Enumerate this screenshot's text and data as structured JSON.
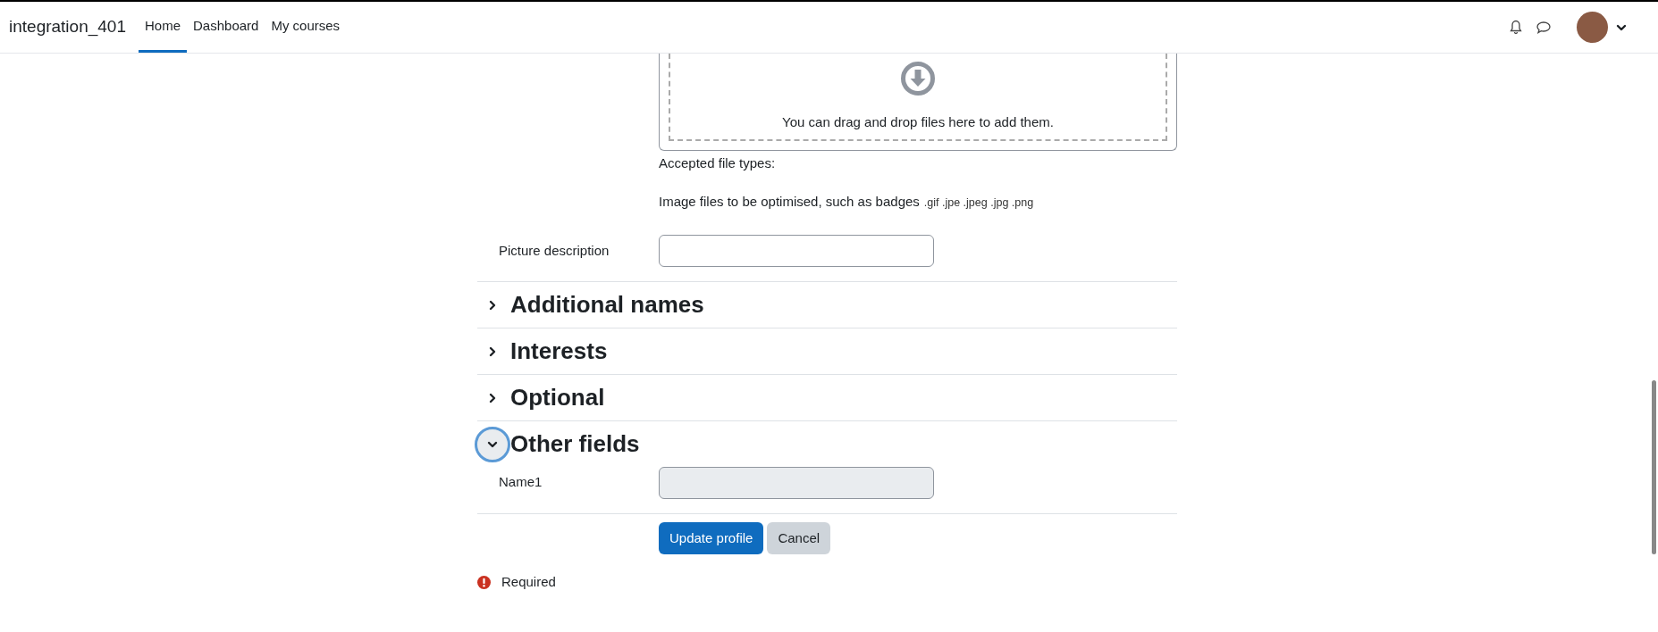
{
  "navbar": {
    "brand": "integration_401",
    "links": [
      {
        "label": "Home",
        "selected": true
      },
      {
        "label": "Dashboard",
        "selected": false
      },
      {
        "label": "My courses",
        "selected": false
      }
    ]
  },
  "filepicker": {
    "drop_hint": "You can drag and drop files here to add them.",
    "accepted_label": "Accepted file types:",
    "accepted_description": "Image files to be optimised, such as badges",
    "extensions": ".gif .jpe .jpeg .jpg .png"
  },
  "picture_description": {
    "label": "Picture description"
  },
  "sections": [
    {
      "title": "Additional names",
      "expanded": false
    },
    {
      "title": "Interests",
      "expanded": false
    },
    {
      "title": "Optional",
      "expanded": false
    },
    {
      "title": "Other fields",
      "expanded": true,
      "fields": [
        {
          "label": "Name1",
          "disabled": true
        }
      ]
    }
  ],
  "buttons": [
    {
      "label": "Update profile",
      "kind": "primary"
    },
    {
      "label": "Cancel",
      "kind": "secondary"
    }
  ],
  "required_note": "Required"
}
